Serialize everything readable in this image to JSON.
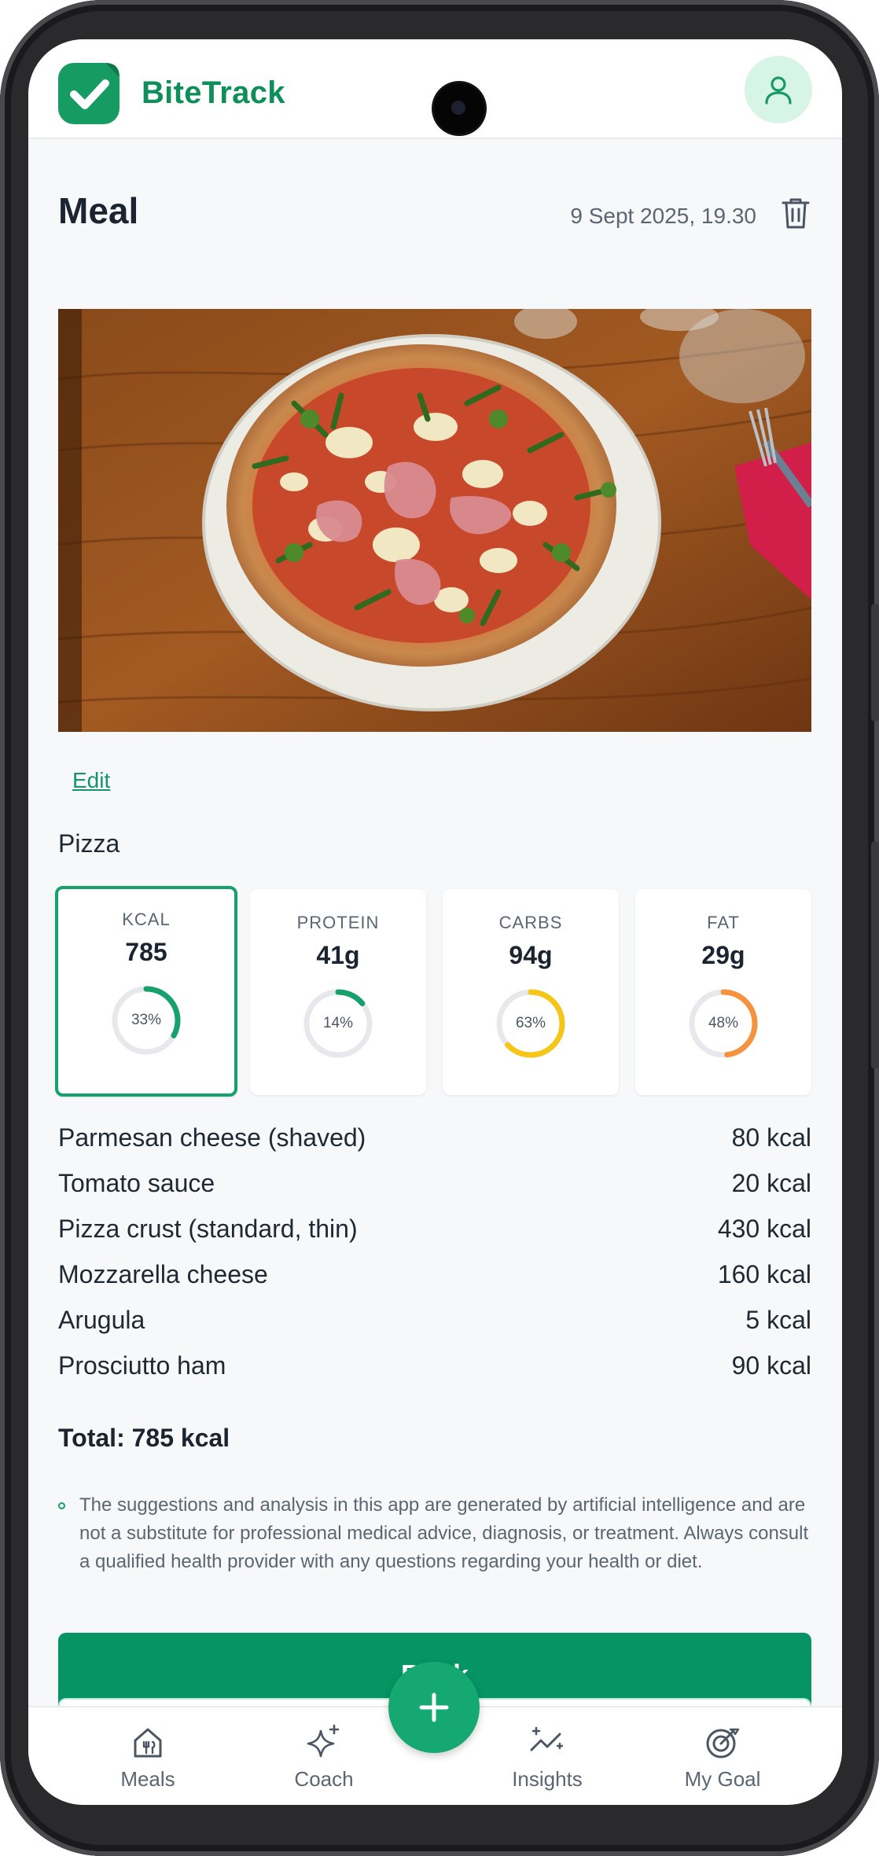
{
  "app": {
    "name": "BiteTrack",
    "accent": "#169b63"
  },
  "meal": {
    "title": "Meal",
    "datetime": "9 Sept 2025, 19.30",
    "edit_label": "Edit",
    "name": "Pizza",
    "photo_alt": "pizza-photo"
  },
  "macros": [
    {
      "label": "KCAL",
      "value": "785",
      "pct_label": "33%",
      "pct": 0.33,
      "color": "#16a06b",
      "selected": true
    },
    {
      "label": "PROTEIN",
      "value": "41g",
      "pct_label": "14%",
      "pct": 0.14,
      "color": "#16a06b",
      "selected": false
    },
    {
      "label": "CARBS",
      "value": "94g",
      "pct_label": "63%",
      "pct": 0.63,
      "color": "#f5c518",
      "selected": false
    },
    {
      "label": "FAT",
      "value": "29g",
      "pct_label": "48%",
      "pct": 0.48,
      "color": "#f5923e",
      "selected": false
    }
  ],
  "items": [
    {
      "name": "Parmesan cheese (shaved)",
      "kcal": "80 kcal"
    },
    {
      "name": "Tomato sauce",
      "kcal": "20 kcal"
    },
    {
      "name": "Pizza crust (standard, thin)",
      "kcal": "430 kcal"
    },
    {
      "name": "Mozzarella cheese",
      "kcal": "160 kcal"
    },
    {
      "name": "Arugula",
      "kcal": "5 kcal"
    },
    {
      "name": "Prosciutto ham",
      "kcal": "90 kcal"
    }
  ],
  "total": "Total: 785 kcal",
  "disclaimer": "The suggestions and analysis in this app are generated by artificial intelligence and are not a substitute for professional medical advice, diagnosis, or treatment. Always consult a qualified health provider with any questions regarding your health or diet.",
  "back_label": "Back",
  "nav": {
    "items": [
      {
        "label": "Meals",
        "icon": "house-fork-icon"
      },
      {
        "label": "Coach",
        "icon": "sparkles-icon"
      },
      {
        "label": "Insights",
        "icon": "trend-sparkle-icon"
      },
      {
        "label": "My Goal",
        "icon": "target-icon"
      }
    ],
    "fab_icon": "plus-icon"
  }
}
